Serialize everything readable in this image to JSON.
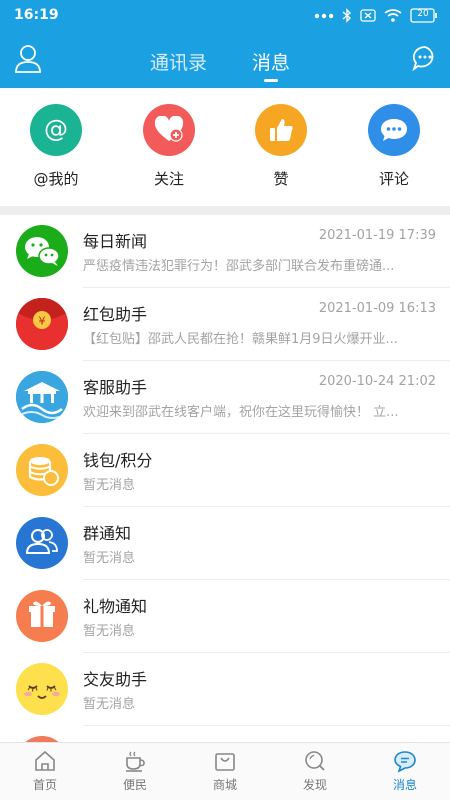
{
  "status": {
    "time": "16:19",
    "battery": "20"
  },
  "header": {
    "tabs": [
      {
        "label": "通讯录"
      },
      {
        "label": "消息"
      }
    ]
  },
  "quick_actions": [
    {
      "label": "@我的",
      "icon": "at-icon",
      "color": "#1ab394"
    },
    {
      "label": "关注",
      "icon": "heart-plus-icon",
      "color": "#f35b5b"
    },
    {
      "label": "赞",
      "icon": "thumbs-up-icon",
      "color": "#f6a623"
    },
    {
      "label": "评论",
      "icon": "comment-icon",
      "color": "#2e8ee8"
    }
  ],
  "messages": [
    {
      "title": "每日新闻",
      "subtitle": "严惩疫情违法犯罪行为！邵武多部门联合发布重磅通...",
      "time": "2021-01-19 17:39",
      "icon": "wechat-icon"
    },
    {
      "title": "红包助手",
      "subtitle": "【红包贴】邵武人民都在抢！赣果鲜1月9日火爆开业...",
      "time": "2021-01-09 16:13",
      "icon": "red-envelope-icon"
    },
    {
      "title": "客服助手",
      "subtitle": "欢迎来到邵武在线客户端，祝你在这里玩得愉快！ 立...",
      "time": "2020-10-24 21:02",
      "icon": "customer-service-icon"
    },
    {
      "title": "钱包/积分",
      "subtitle": "暂无消息",
      "time": "",
      "icon": "coins-icon"
    },
    {
      "title": "群通知",
      "subtitle": "暂无消息",
      "time": "",
      "icon": "group-icon"
    },
    {
      "title": "礼物通知",
      "subtitle": "暂无消息",
      "time": "",
      "icon": "gift-icon"
    },
    {
      "title": "交友助手",
      "subtitle": "暂无消息",
      "time": "",
      "icon": "smiley-icon"
    }
  ],
  "bottom_nav": [
    {
      "label": "首页",
      "icon": "home-icon"
    },
    {
      "label": "便民",
      "icon": "cup-icon"
    },
    {
      "label": "商城",
      "icon": "shopping-bag-icon"
    },
    {
      "label": "发现",
      "icon": "discover-icon"
    },
    {
      "label": "消息",
      "icon": "message-icon",
      "active": true
    }
  ],
  "colors": {
    "primary": "#1ba0e1",
    "active_nav": "#1c86d0"
  }
}
